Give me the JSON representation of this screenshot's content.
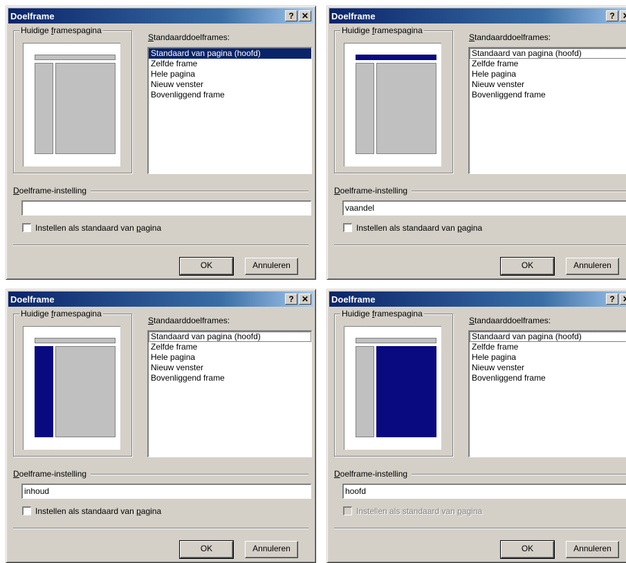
{
  "dialogs": [
    {
      "title": "Doelframe",
      "help_glyph": "?",
      "close_glyph": "✕",
      "group_label_pre": "Huidige ",
      "group_label_accel": "f",
      "group_label_post": "ramespagina",
      "list_label_accel": "S",
      "list_label_post": "tandaarddoelframes:",
      "list_items": [
        "Standaard van pagina (hoofd)",
        "Zelfde frame",
        "Hele pagina",
        "Nieuw venster",
        "Bovenliggend frame"
      ],
      "selected_index": 0,
      "selected_frame": "none",
      "section_label_accel": "D",
      "section_label_post": "oelframe-instelling",
      "target_value": "",
      "checkbox_label_pre": "Instellen als standaard van ",
      "checkbox_label_accel": "p",
      "checkbox_label_post": "agina",
      "checkbox_checked": false,
      "checkbox_disabled": false,
      "ok_label": "OK",
      "cancel_label": "Annuleren"
    },
    {
      "title": "Doelframe",
      "help_glyph": "?",
      "close_glyph": "✕",
      "group_label_pre": "Huidige ",
      "group_label_accel": "f",
      "group_label_post": "ramespagina",
      "list_label_accel": "S",
      "list_label_post": "tandaarddoelframes:",
      "list_items": [
        "Standaard van pagina (hoofd)",
        "Zelfde frame",
        "Hele pagina",
        "Nieuw venster",
        "Bovenliggend frame"
      ],
      "selected_index": -1,
      "selected_frame": "top",
      "section_label_accel": "D",
      "section_label_post": "oelframe-instelling",
      "target_value": "vaandel",
      "checkbox_label_pre": "Instellen als standaard van ",
      "checkbox_label_accel": "p",
      "checkbox_label_post": "agina",
      "checkbox_checked": false,
      "checkbox_disabled": false,
      "ok_label": "OK",
      "cancel_label": "Annuleren"
    },
    {
      "title": "Doelframe",
      "help_glyph": "?",
      "close_glyph": "✕",
      "group_label_pre": "Huidige ",
      "group_label_accel": "f",
      "group_label_post": "ramespagina",
      "list_label_accel": "S",
      "list_label_post": "tandaarddoelframes:",
      "list_items": [
        "Standaard van pagina (hoofd)",
        "Zelfde frame",
        "Hele pagina",
        "Nieuw venster",
        "Bovenliggend frame"
      ],
      "selected_index": -1,
      "selected_frame": "left",
      "section_label_accel": "D",
      "section_label_post": "oelframe-instelling",
      "target_value": "inhoud",
      "checkbox_label_pre": "Instellen als standaard van ",
      "checkbox_label_accel": "p",
      "checkbox_label_post": "agina",
      "checkbox_checked": false,
      "checkbox_disabled": false,
      "ok_label": "OK",
      "cancel_label": "Annuleren"
    },
    {
      "title": "Doelframe",
      "help_glyph": "?",
      "close_glyph": "✕",
      "group_label_pre": "Huidige ",
      "group_label_accel": "f",
      "group_label_post": "ramespagina",
      "list_label_accel": "S",
      "list_label_post": "tandaarddoelframes:",
      "list_items": [
        "Standaard van pagina (hoofd)",
        "Zelfde frame",
        "Hele pagina",
        "Nieuw venster",
        "Bovenliggend frame"
      ],
      "selected_index": -1,
      "selected_frame": "main",
      "section_label_accel": "D",
      "section_label_post": "oelframe-instelling",
      "target_value": "hoofd",
      "checkbox_label_pre": "Instellen als standaard van ",
      "checkbox_label_accel": "p",
      "checkbox_label_post": "agina",
      "checkbox_checked": false,
      "checkbox_disabled": true,
      "ok_label": "OK",
      "cancel_label": "Annuleren"
    }
  ]
}
